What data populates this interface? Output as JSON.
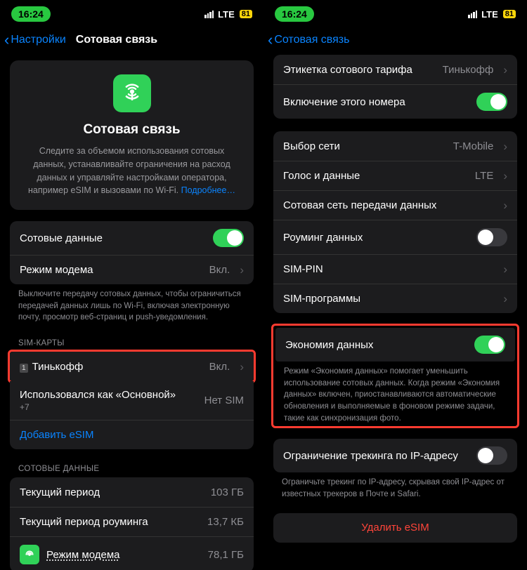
{
  "status": {
    "time": "16:24",
    "network": "LTE",
    "battery": "81"
  },
  "left": {
    "back": "Настройки",
    "title": "Сотовая связь",
    "hero": {
      "title": "Сотовая связь",
      "desc": "Следите за объемом использования сотовых данных, устанавливайте ограничения на расход данных и управляйте настройками оператора, например eSIM и вызовами по Wi-Fi.",
      "more": "Подробнее…"
    },
    "g1": {
      "cellular_data": "Сотовые данные",
      "hotspot": "Режим модема",
      "hotspot_value": "Вкл.",
      "footer": "Выключите передачу сотовых данных, чтобы ограничиться передачей данных лишь по Wi-Fi, включая электронную почту, просмотр веб-страниц и push-уведомления."
    },
    "g2": {
      "header": "SIM-КАРТЫ",
      "tinkoff": "Тинькофф",
      "tinkoff_value": "Вкл.",
      "used_as": "Использовался как «Основной»",
      "used_sub": "+7",
      "used_value": "Нет SIM",
      "add_esim": "Добавить eSIM"
    },
    "g3": {
      "header": "СОТОВЫЕ ДАННЫЕ",
      "period": "Текущий период",
      "period_val": "103 ГБ",
      "roaming": "Текущий период роуминга",
      "roaming_val": "13,7 КБ",
      "hotspot2": "Режим модема",
      "hotspot2_val": "78,1 ГБ"
    }
  },
  "right": {
    "back": "Сотовая связь",
    "g1": {
      "label_row": "Этикетка сотового тарифа",
      "label_val": "Тинькофф",
      "enable_num": "Включение этого номера"
    },
    "g2": {
      "net_select": "Выбор сети",
      "net_val": "T-Mobile",
      "voice_data": "Голос и данные",
      "voice_val": "LTE",
      "cell_net": "Сотовая сеть передачи данных",
      "roaming": "Роуминг данных",
      "sim_pin": "SIM-PIN",
      "sim_apps": "SIM-программы"
    },
    "g3": {
      "low_data": "Экономия данных",
      "footer": "Режим «Экономия данных» помогает уменьшить использование сотовых данных. Когда режим «Экономия данных» включен, приостанавливаются автоматические обновления и выполняемые в фоновом режиме задачи, такие как синхронизация фото."
    },
    "g4": {
      "ip_track": "Ограничение трекинга по IP-адресу",
      "footer": "Ограничьте трекинг по IP-адресу, скрывая свой IP-адрес от известных трекеров в Почте и Safari."
    },
    "delete": "Удалить eSIM"
  }
}
